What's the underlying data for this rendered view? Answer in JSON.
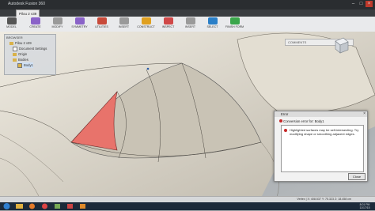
{
  "window": {
    "title": "Autodesk Fusion 360"
  },
  "tabs": [
    {
      "label": "Pilou 2 v39"
    }
  ],
  "ribbon": {
    "workspace_label": "MODEL",
    "tools": [
      {
        "label": "CREATE",
        "color": "#8a63c8"
      },
      {
        "label": "MODIFY",
        "color": "#9a9a9a"
      },
      {
        "label": "SYMMETRY",
        "color": "#8a63c8"
      },
      {
        "label": "UTILITIES",
        "color": "#c84a3a"
      },
      {
        "label": "INSERT",
        "color": "#9a9a9a"
      },
      {
        "label": "CONSTRUCT",
        "color": "#e0a020"
      },
      {
        "label": "INSPECT",
        "color": "#d04848"
      },
      {
        "label": "INSERT",
        "color": "#9a9a9a"
      },
      {
        "label": "SELECT",
        "color": "#2a7fc8"
      },
      {
        "label": "FINISH FORM",
        "color": "#3aa64a"
      }
    ]
  },
  "browser": {
    "header": "BROWSER",
    "items": [
      {
        "label": "Pilou 2 v39"
      },
      {
        "label": "Document Settings"
      },
      {
        "label": "Origin"
      },
      {
        "label": "Bodies"
      },
      {
        "label": "Body1"
      }
    ]
  },
  "comments": {
    "label": "COMMENTS"
  },
  "dialog": {
    "title": "Error",
    "summary": "Conversion error for: Body1",
    "detail": "Highlighted surfaces may be self-intersecting. Try modifying shape or smoothing adjacent edges.",
    "close_label": "Close"
  },
  "status": {
    "vertex": "Vertex | X: 408.537 Y: 75.323 Z: 18.458 cm"
  },
  "taskbar": {
    "time": "8:01 PM",
    "date": "11/17/15"
  },
  "colors": {
    "highlight": "#e8736b",
    "surface": "#ddd8cc",
    "background": "#9ba0a4"
  }
}
